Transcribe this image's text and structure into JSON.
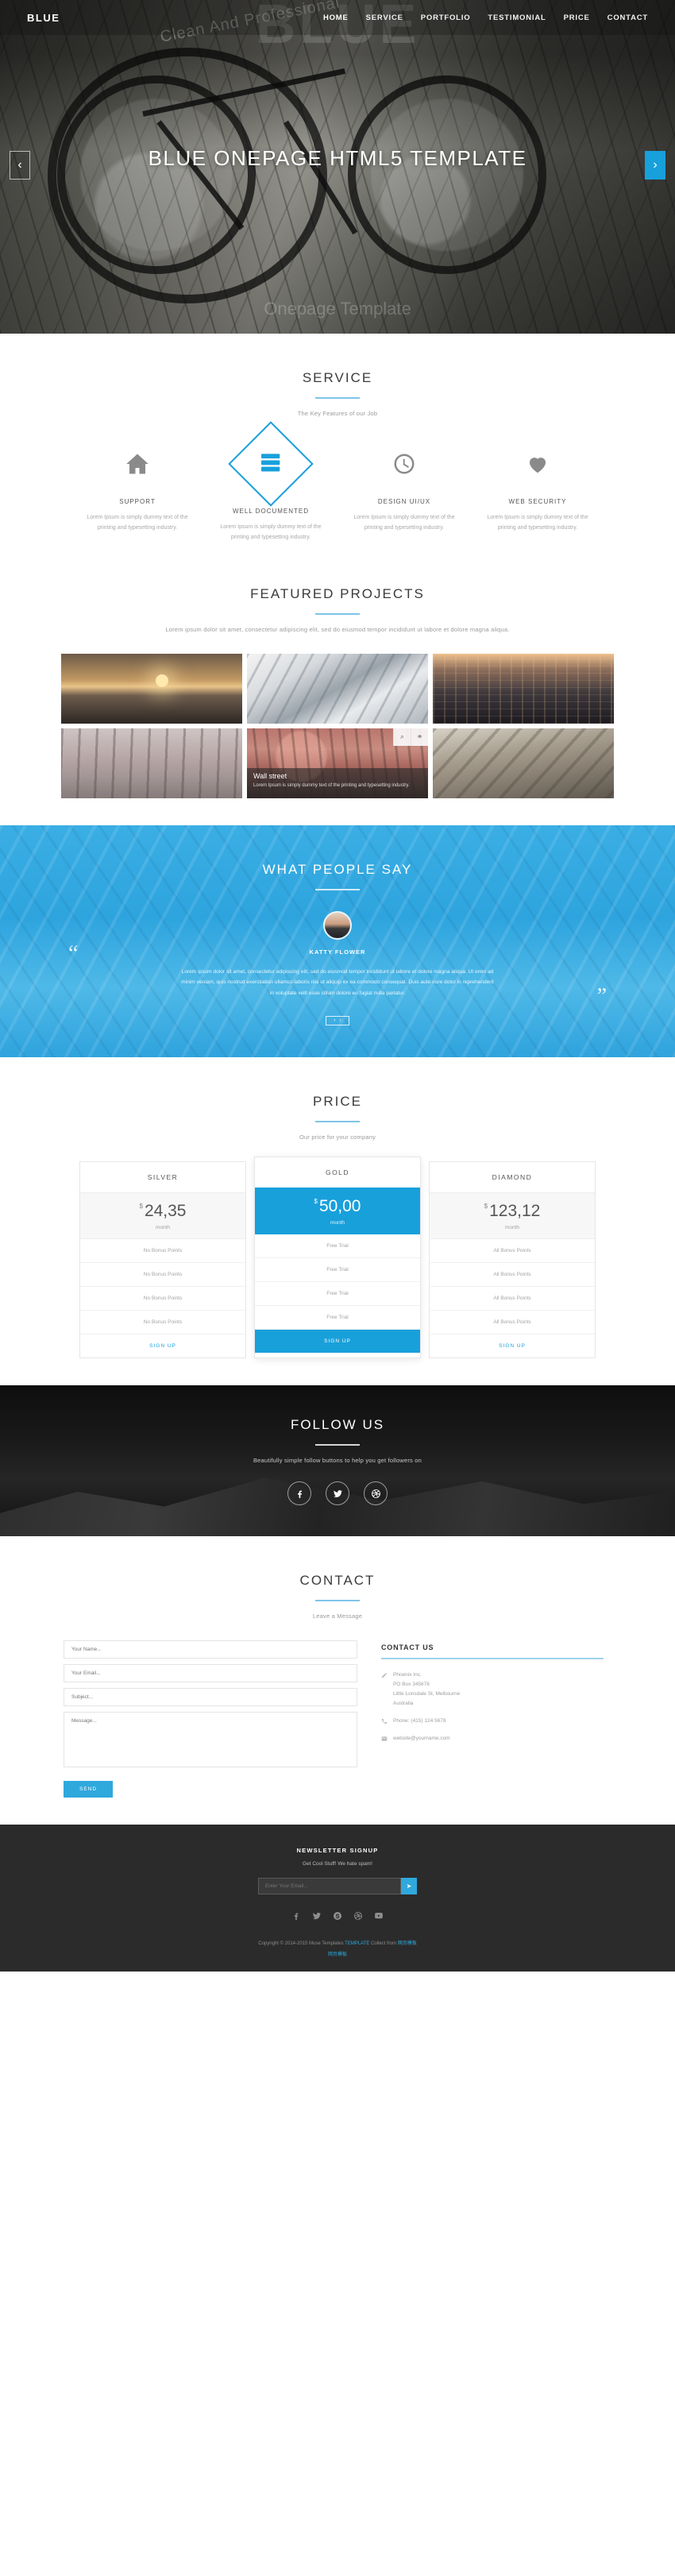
{
  "nav": {
    "brand": "BLUE",
    "links": [
      "HOME",
      "SERVICE",
      "PORTFOLIO",
      "TESTIMONIAL",
      "PRICE",
      "CONTACT"
    ]
  },
  "hero": {
    "ghost_top": "BLUE",
    "ghost_angled": "Clean And Professional",
    "ghost_bottom": "Onepage Template",
    "title": "BLUE ONEPAGE HTML5 TEMPLATE",
    "prev": "‹",
    "next": "›"
  },
  "service": {
    "title": "SERVICE",
    "subtitle": "The Key Features of our Job",
    "items": [
      {
        "icon": "home-icon",
        "name": "SUPPORT",
        "text": "Lorem Ipsum is simply dummy text of the printing and typesetting industry."
      },
      {
        "icon": "server-icon",
        "name": "WELL DOCUMENTED",
        "text": "Lorem Ipsum is simply dummy text of the printing and typesetting industry."
      },
      {
        "icon": "clock-icon",
        "name": "DESIGN UI/UX",
        "text": "Lorem Ipsum is simply dummy text of the printing and typesetting industry."
      },
      {
        "icon": "heart-icon",
        "name": "WEB SECURITY",
        "text": "Lorem Ipsum is simply dummy text of the printing and typesetting industry."
      }
    ]
  },
  "portfolio": {
    "title": "FEATURED PROJECTS",
    "subtitle": "Lorem ipsum dolor sit amet, consectetur adipiscing elit, sed do eiusmod tempor incididunt ut labore et dolore magna aliqua.",
    "tiles": [
      {
        "alt": "sunset-over-sea"
      },
      {
        "alt": "snow-mountain"
      },
      {
        "alt": "city-street-at-night"
      },
      {
        "alt": "park-bench"
      },
      {
        "alt": "blossom-trees",
        "caption_title": "Wall street",
        "caption_text": "Lorem Ipsum is simply dummy text of the printing and typesetting industry.",
        "zoom_icon": "⌕",
        "link_icon": "⚭"
      },
      {
        "alt": "rock-arch"
      }
    ]
  },
  "testimonial": {
    "title": "WHAT PEOPLE SAY",
    "name": "KATTY FLOWER",
    "quote": "Lorem ipsum dolor sit amet, consectetur adipiscing elit, sed do eiusmod tempor incididunt ut labore et dolore magna aliqua. Ut enim ad minim veniam, quis nostrud exercitation ullamco laboris nisi ut aliquip ex ea commodo consequat. Duis aute irure dolor in reprehenderit in voluptate velit esse cillum dolore eu fugiat nulla pariatur.",
    "quote_open": "“",
    "quote_close": "”",
    "nav_prev": "‹",
    "nav_next": "›"
  },
  "price": {
    "title": "PRICE",
    "subtitle": "Our price for your company",
    "plans": [
      {
        "name": "SILVER",
        "currency": "$",
        "amount": "24,35",
        "per": "month",
        "features": [
          "No Bonus Points",
          "No Bonus Points",
          "No Bonus Points",
          "No Bonus Points"
        ],
        "button": "SIGN UP",
        "popular": false
      },
      {
        "name": "GOLD",
        "currency": "$",
        "amount": "50,00",
        "per": "month",
        "features": [
          "Free Trial",
          "Free Trial",
          "Free Trial",
          "Free Trial"
        ],
        "button": "SIGN UP",
        "popular": true
      },
      {
        "name": "DIAMOND",
        "currency": "$",
        "amount": "123,12",
        "per": "month",
        "features": [
          "All Bonus Points",
          "All Bonus Points",
          "All Bonus Points",
          "All Bonus Points"
        ],
        "button": "SIGN UP",
        "popular": false
      }
    ]
  },
  "follow": {
    "title": "FOLLOW US",
    "subtitle": "Beautifully simple follow buttons to help you get followers on",
    "buttons": [
      {
        "icon": "facebook-icon",
        "label": "Facebook"
      },
      {
        "icon": "twitter-icon",
        "label": "Twitter"
      },
      {
        "icon": "dribbble-icon",
        "label": "Dribbble"
      }
    ]
  },
  "contact": {
    "title": "CONTACT",
    "subtitle": "Leave a Message",
    "form": {
      "name_placeholder": "Your Name...",
      "email_placeholder": "Your Email...",
      "subject_placeholder": "Subject...",
      "message_placeholder": "Message...",
      "send_label": "SEND"
    },
    "info": {
      "heading": "CONTACT US",
      "address_lines": [
        "Phoenix Inc.",
        "PO Box 345678",
        "Little Lonsdale St, Melbourne",
        "Australia"
      ],
      "phone": "Phone: (415) 124 5678",
      "email": "website@yourname.com",
      "address_icon": "pencil-icon",
      "phone_icon": "phone-icon",
      "email_icon": "envelope-icon"
    }
  },
  "footer": {
    "newsletter_title": "NEWSLETTER SIGNUP",
    "newsletter_sub": "Get Cool Stuff! We hate spam!",
    "email_placeholder": "Enter Your Email...",
    "submit_icon": "➤",
    "social": [
      {
        "icon": "facebook-icon"
      },
      {
        "icon": "twitter-icon"
      },
      {
        "icon": "skype-icon"
      },
      {
        "icon": "dribbble-icon"
      },
      {
        "icon": "youtube-icon"
      }
    ],
    "copyright_prefix": "Copyright © 2014-2015 Muse Templates ",
    "copyright_link1": "TEMPLATE",
    "copyright_mid": " Collect from ",
    "copyright_link2": "网页模板",
    "bottom_link": "网页模板"
  },
  "colors": {
    "accent": "#18a0db",
    "accent_light": "#7fc4e8",
    "dark": "#2b2b2b"
  }
}
